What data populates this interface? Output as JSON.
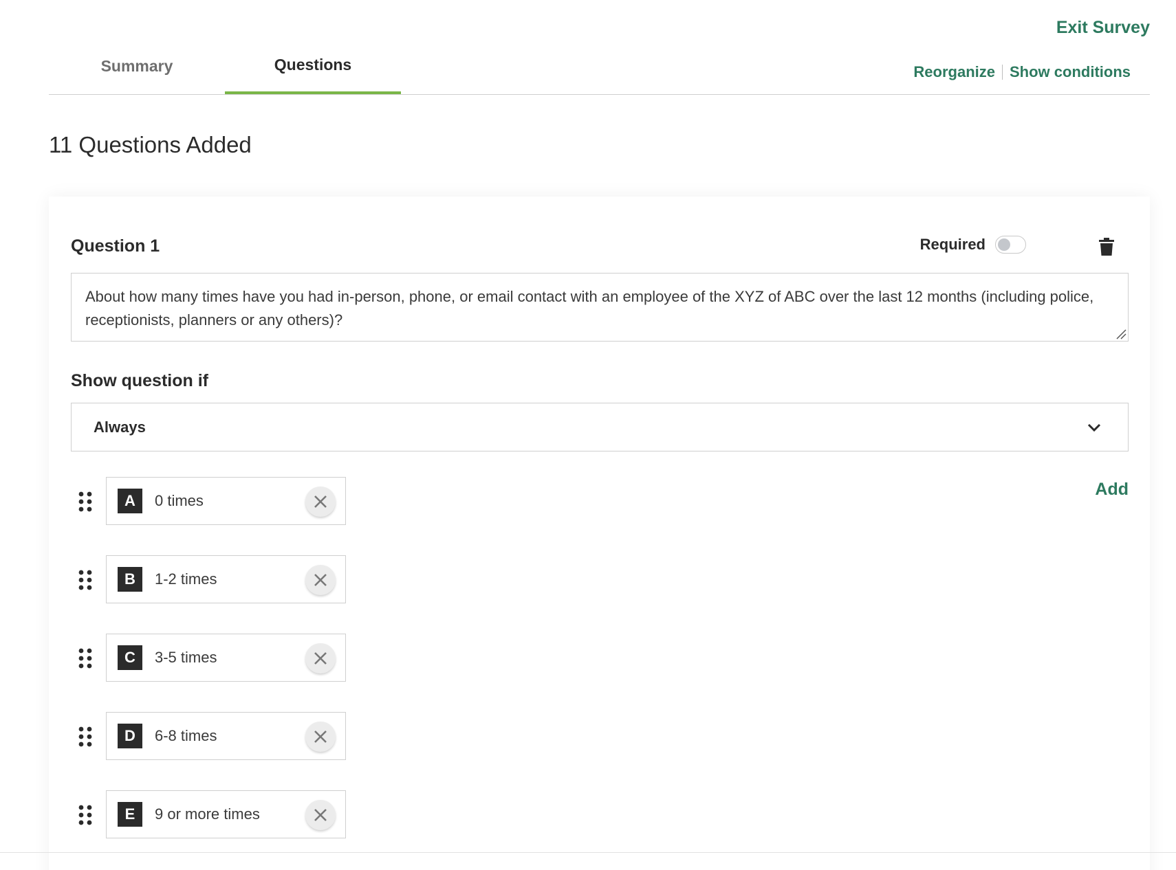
{
  "header": {
    "exit_label": "Exit Survey",
    "tabs": [
      {
        "label": "Summary",
        "active": false
      },
      {
        "label": "Questions",
        "active": true
      }
    ],
    "links": {
      "reorganize": "Reorganize",
      "show_conditions": "Show conditions"
    }
  },
  "summary": {
    "count_title": "11 Questions Added"
  },
  "question": {
    "label": "Question 1",
    "required_label": "Required",
    "required_on": false,
    "text": "About how many times have you had in-person, phone, or email contact with an employee of the XYZ of ABC over the last 12 months (including police, receptionists, planners or any others)?",
    "show_if_label": "Show question if",
    "show_if_value": "Always",
    "add_label": "Add",
    "answers": [
      {
        "letter": "A",
        "text": "0 times"
      },
      {
        "letter": "B",
        "text": "1-2 times"
      },
      {
        "letter": "C",
        "text": "3-5 times"
      },
      {
        "letter": "D",
        "text": "6-8 times"
      },
      {
        "letter": "E",
        "text": "9 or more times"
      }
    ]
  },
  "colors": {
    "accent_green": "#2d7a5f",
    "tab_underline": "#7ab648",
    "letter_badge": "#2b2b2b"
  }
}
